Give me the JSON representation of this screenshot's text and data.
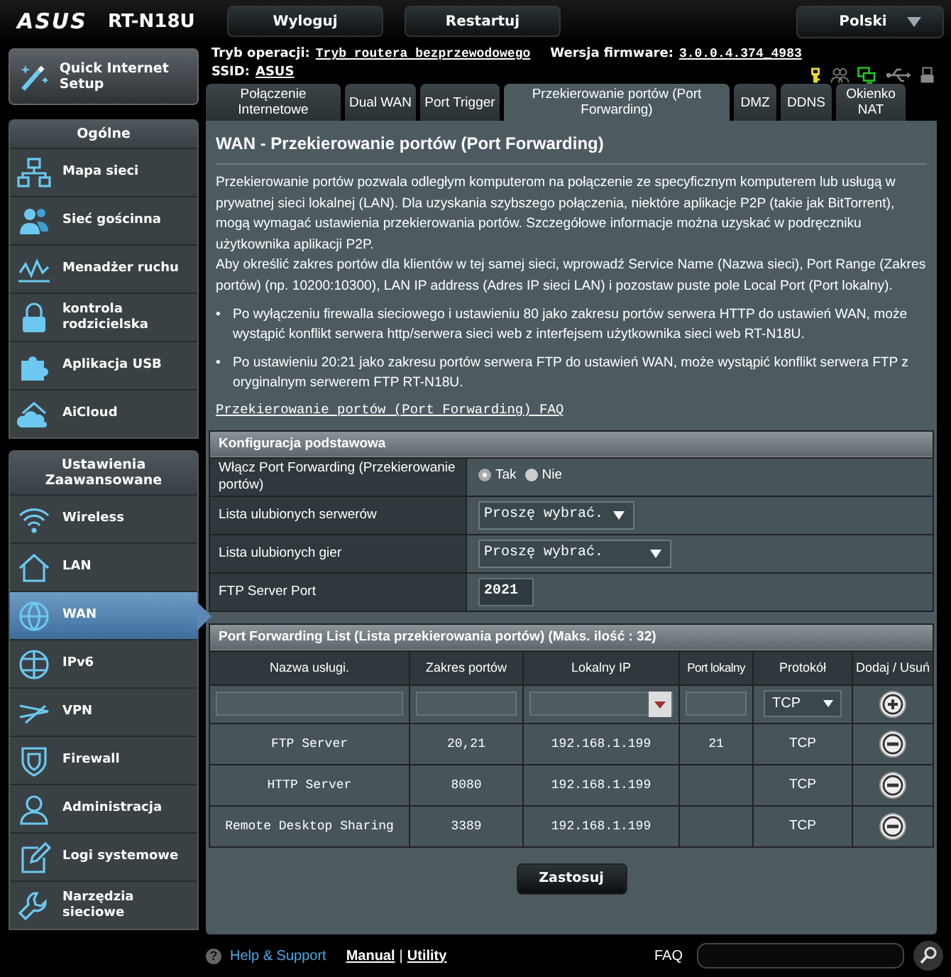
{
  "header": {
    "logo": "ASUS",
    "model": "RT-N18U",
    "buttons": [
      "Wyloguj",
      "Restartuj"
    ],
    "language": "Polski"
  },
  "info": {
    "mode_label": "Tryb operacji:",
    "mode": "Tryb routera bezprzewodowego",
    "firmware_label": "Wersja firmware:",
    "firmware": "3.0.0.4.374_4983",
    "ssid_label": "SSID:",
    "ssid": "ASUS"
  },
  "quick_setup": "Quick Internet Setup",
  "sidebar": [
    {
      "title": "Ogólne",
      "items": [
        {
          "label": "Mapa sieci",
          "selected": false
        },
        {
          "label": "Sieć gościnna",
          "selected": false
        },
        {
          "label": "Menadżer ruchu",
          "selected": false
        },
        {
          "label": "kontrola rodzicielska",
          "selected": false
        },
        {
          "label": "Aplikacja USB",
          "selected": false
        },
        {
          "label": "AiCloud",
          "selected": false
        }
      ]
    },
    {
      "title": "Ustawienia Zaawansowane",
      "items": [
        {
          "label": "Wireless",
          "selected": false
        },
        {
          "label": "LAN",
          "selected": false
        },
        {
          "label": "WAN",
          "selected": true
        },
        {
          "label": "IPv6",
          "selected": false
        },
        {
          "label": "VPN",
          "selected": false
        },
        {
          "label": "Firewall",
          "selected": false
        },
        {
          "label": "Administracja",
          "selected": false
        },
        {
          "label": "Logi systemowe",
          "selected": false
        },
        {
          "label": "Narzędzia sieciowe",
          "selected": false
        }
      ]
    }
  ],
  "tabs": [
    {
      "label": "Połączenie Internetowe",
      "selected": false
    },
    {
      "label": "Dual WAN",
      "selected": false
    },
    {
      "label": "Port Trigger",
      "selected": false
    },
    {
      "label": "Przekierowanie portów (Port Forwarding)",
      "selected": true
    },
    {
      "label": "DMZ",
      "selected": false
    },
    {
      "label": "DDNS",
      "selected": false
    },
    {
      "label": "Okienko NAT",
      "selected": false
    }
  ],
  "page": {
    "title": "WAN - Przekierowanie portów (Port Forwarding)",
    "intro": [
      "Przekierowanie portów pozwala odległym komputerom na połączenie ze specyficznym komputerem lub usługą w prywatnej sieci lokalnej (LAN). Dla uzyskania szybszego połączenia, niektóre aplikacje P2P (takie jak BitTorrent), mogą wymagać ustawienia przekierowania portów. Szczegółowe informacje można uzyskać w podręczniku użytkownika aplikacji P2P.",
      "Aby określić zakres portów dla klientów w tej samej sieci, wprowadź Service Name (Nazwa sieci), Port Range (Zakres portów) (np. 10200:10300), LAN IP address (Adres IP sieci LAN) i pozostaw puste pole Local Port (Port lokalny)."
    ],
    "note_marker": "•",
    "notes": [
      "Po wyłączeniu firewalla sieciowego i ustawieniu 80 jako zakresu portów serwera HTTP do ustawień WAN, może wystąpić konflikt serwera http/serwera sieci web z interfejsem użytkownika sieci web RT-N18U.",
      "Po ustawieniu 20:21 jako zakresu portów serwera FTP do ustawień WAN, może wystąpić konflikt serwera FTP z oryginalnym serwerem FTP RT-N18U."
    ],
    "faq_link": "Przekierowanie portów (Port Forwarding) FAQ"
  },
  "basic_config": {
    "title": "Konfiguracja podstawowa",
    "rows": [
      {
        "kind": "radio",
        "label": "Włącz Port Forwarding (Przekierowanie portów)",
        "options": [
          {
            "label": "Tak",
            "selected": true
          },
          {
            "label": "Nie",
            "selected": false
          }
        ]
      },
      {
        "kind": "select",
        "label": "Lista ulubionych serwerów",
        "value": "Proszę wybrać."
      },
      {
        "kind": "select_wide",
        "label": "Lista ulubionych gier",
        "value": "Proszę wybrać."
      },
      {
        "kind": "input",
        "label": "FTP Server Port",
        "value": "2021"
      }
    ]
  },
  "port_list": {
    "title": "Port Forwarding List (Lista przekierowania portów) (Maks. ilość : 32)",
    "columns": [
      "Nazwa usługi.",
      "Zakres portów",
      "Lokalny IP",
      "Port lokalny",
      "Protokół",
      "Dodaj / Usuń"
    ],
    "new_row": {
      "protocol": "TCP"
    },
    "rows": [
      {
        "service": "FTP Server",
        "port_range": "20,21",
        "local_ip": "192.168.1.199",
        "local_port": "21",
        "protocol": "TCP"
      },
      {
        "service": "HTTP Server",
        "port_range": "8080",
        "local_ip": "192.168.1.199",
        "protocol": "TCP"
      },
      {
        "service": "Remote Desktop Sharing",
        "port_range": "3389",
        "local_ip": "192.168.1.199",
        "protocol": "TCP"
      }
    ]
  },
  "apply_button": "Zastosuj",
  "footer": {
    "help_icon": "?",
    "help": "Help & Support",
    "links": [
      "Manual",
      "Utility"
    ],
    "separator": "|",
    "faq": "FAQ"
  }
}
